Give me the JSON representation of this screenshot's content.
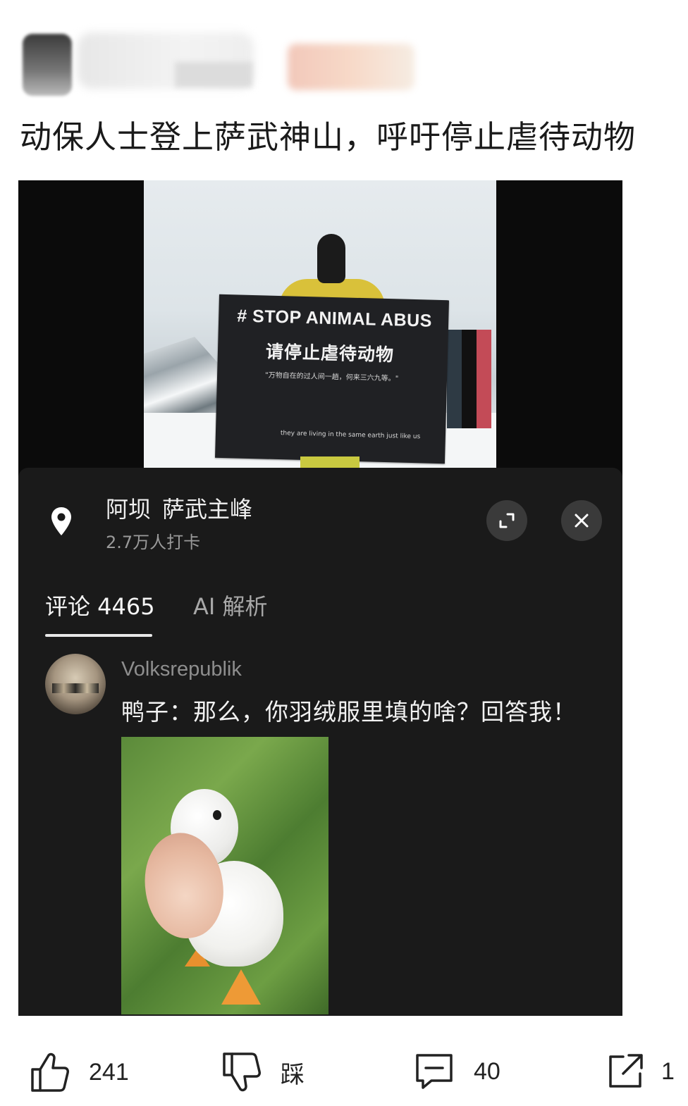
{
  "post": {
    "title": "动保人士登上萨武神山，呼吁停止虐待动物"
  },
  "photo": {
    "banner_line1": "# STOP ANIMAL ABUS",
    "banner_line2": "请停止虐待动物",
    "banner_line3": "\"万物自在的过人间一趟，何来三六九等。\"",
    "banner_line4": "they are living in the same earth just like us"
  },
  "location": {
    "region": "阿坝",
    "peak": "萨武主峰",
    "checkins": "2.7万人打卡"
  },
  "tabs": [
    {
      "label": "评论 4465",
      "active": true
    },
    {
      "label": "AI 解析",
      "active": false
    }
  ],
  "comment": {
    "username": "Volksrepublik",
    "text": "鸭子：那么，你羽绒服里填的啥？回答我！",
    "image_icon": "duck-photo"
  },
  "actions": {
    "like_count": "241",
    "dislike_label": "踩",
    "comment_count": "40",
    "share_count": "1"
  },
  "icons": [
    "location-pin-icon",
    "expand-icon",
    "close-icon",
    "thumbs-up-icon",
    "thumbs-down-icon",
    "comment-icon",
    "share-icon"
  ],
  "colors": {
    "panel_bg": "#1a1a1a",
    "page_bg": "#ffffff",
    "text_dark": "#1a1a1a"
  }
}
